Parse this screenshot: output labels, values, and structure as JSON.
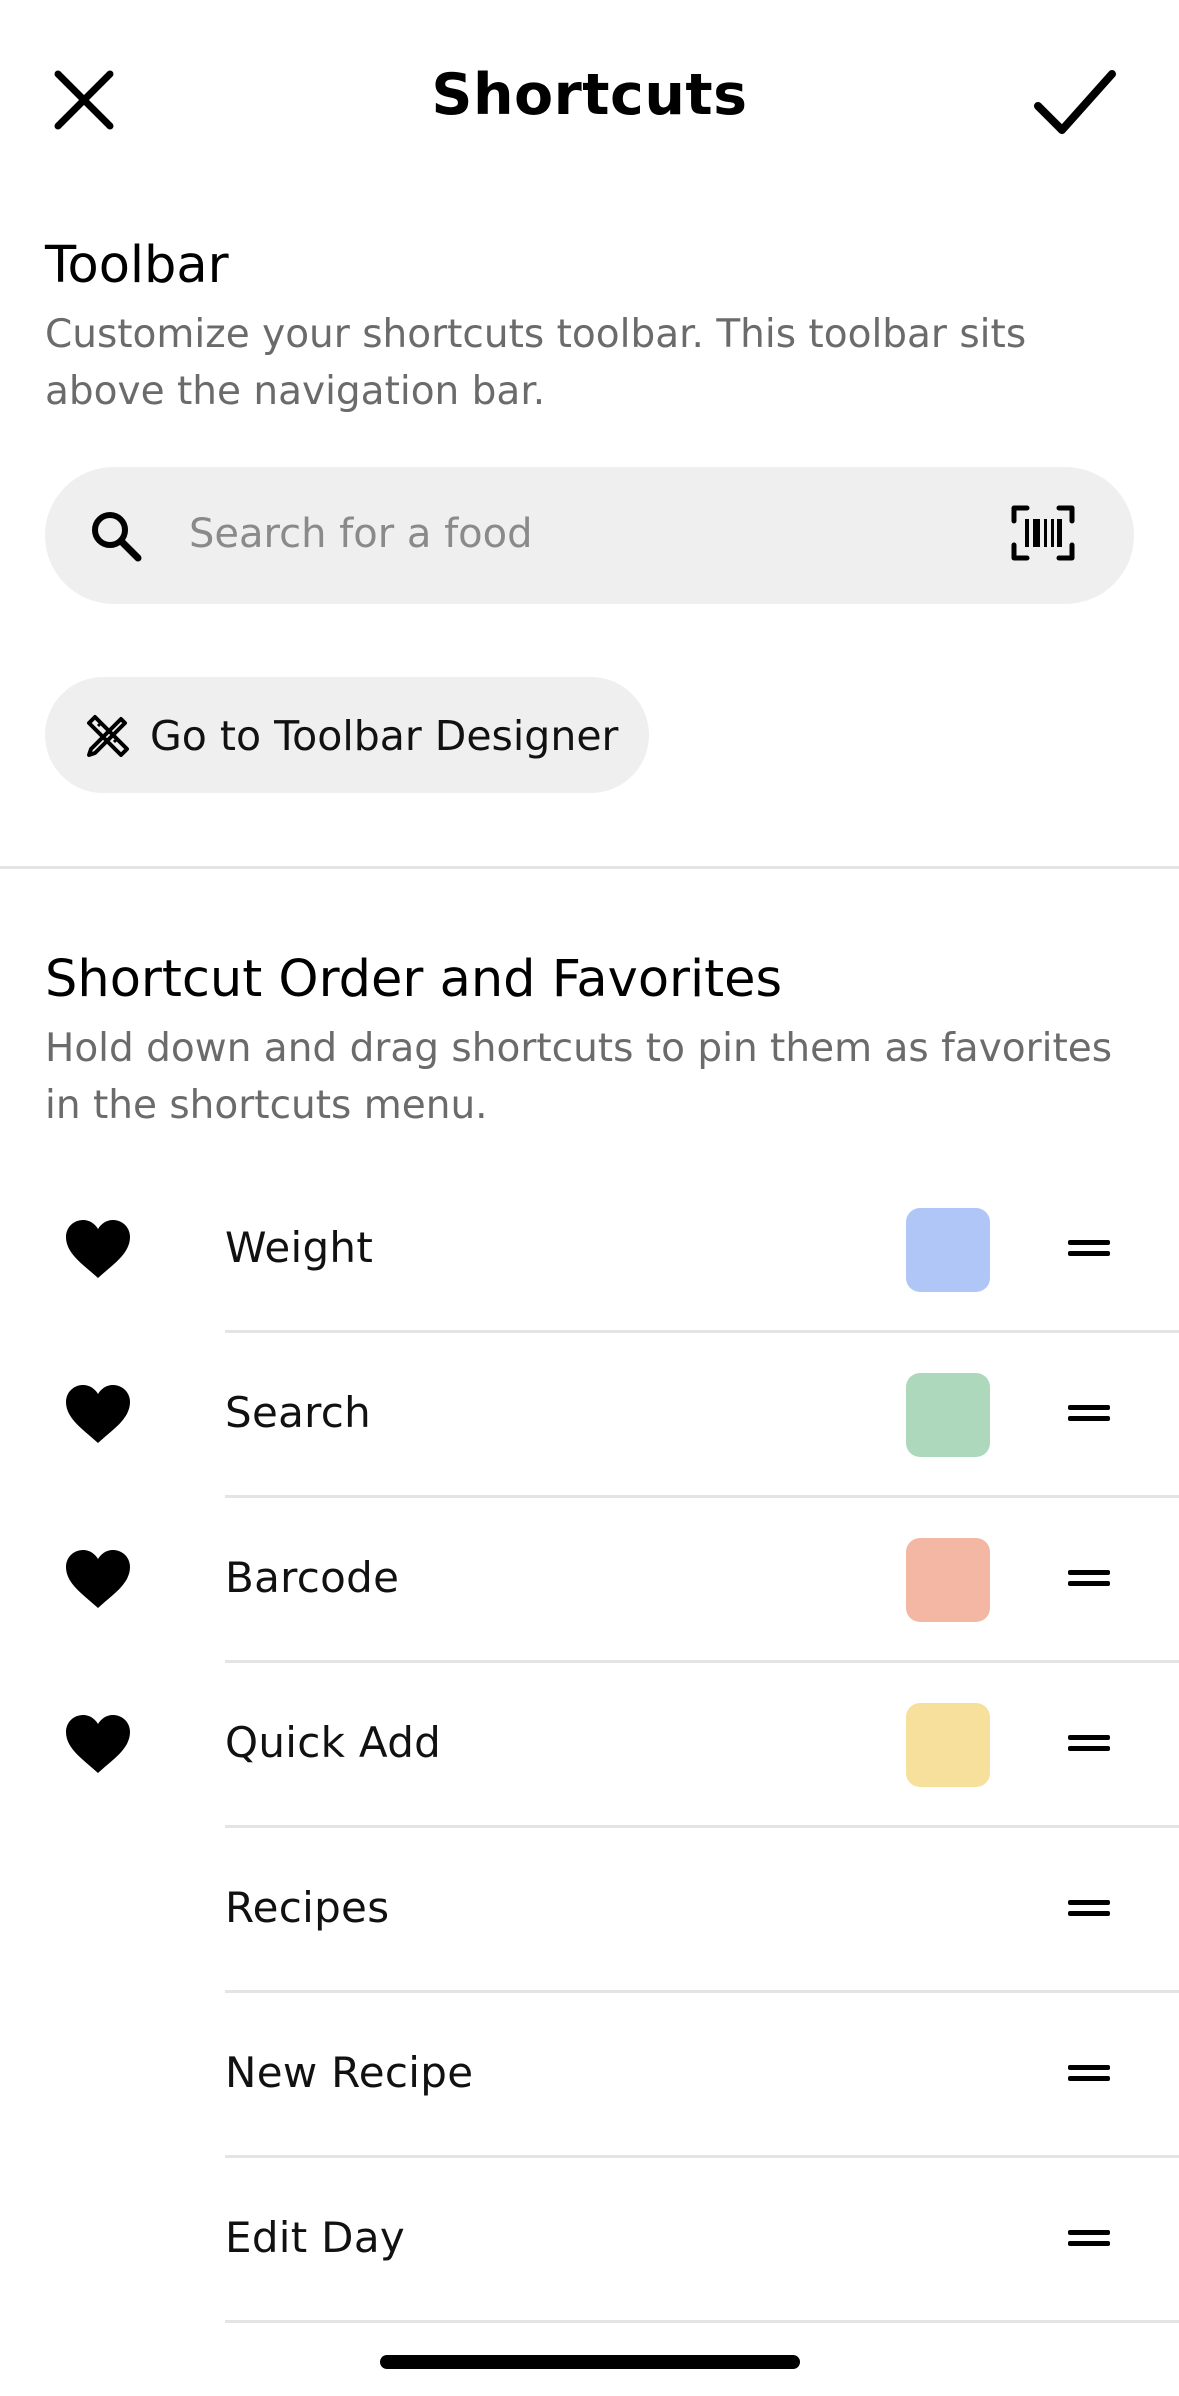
{
  "header": {
    "title": "Shortcuts",
    "close_icon": "close-icon",
    "confirm_icon": "checkmark-icon"
  },
  "toolbar_section": {
    "title": "Toolbar",
    "description": "Customize your shortcuts toolbar. This toolbar sits above the navigation bar.",
    "search": {
      "placeholder": "Search for a food",
      "icon": "search-icon",
      "barcode_icon": "barcode-scan-icon"
    },
    "designer_button": {
      "label": "Go to Toolbar Designer",
      "icon": "design-tools-icon"
    }
  },
  "order_section": {
    "title": "Shortcut Order and Favorites",
    "description": "Hold down and drag shortcuts to pin them as favorites in the shortcuts menu.",
    "items": [
      {
        "label": "Weight",
        "favorite": true,
        "color": "#b0c6f7"
      },
      {
        "label": "Search",
        "favorite": true,
        "color": "#aed8bb"
      },
      {
        "label": "Barcode",
        "favorite": true,
        "color": "#f3b7a3"
      },
      {
        "label": "Quick Add",
        "favorite": true,
        "color": "#f7df9c"
      },
      {
        "label": "Recipes",
        "favorite": false,
        "color": ""
      },
      {
        "label": "New Recipe",
        "favorite": false,
        "color": ""
      },
      {
        "label": "Edit Day",
        "favorite": false,
        "color": ""
      }
    ]
  }
}
